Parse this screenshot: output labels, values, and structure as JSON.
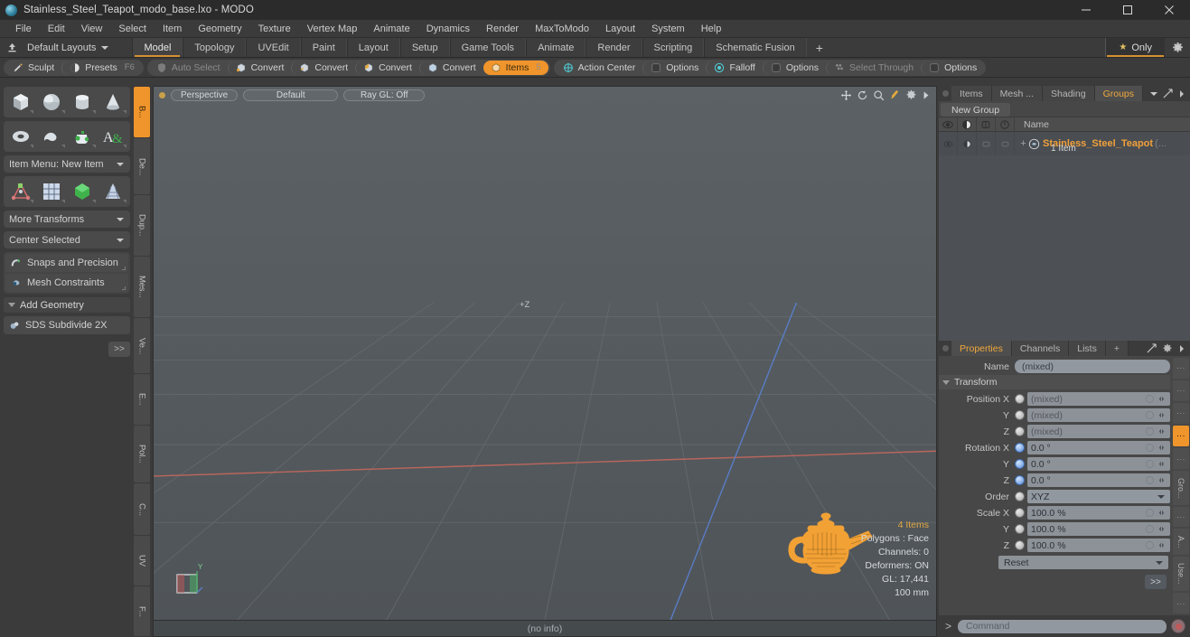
{
  "window": {
    "title": "Stainless_Steel_Teapot_modo_base.lxo - MODO",
    "minimize": "minimize-icon",
    "maximize": "maximize-icon",
    "close": "close-icon"
  },
  "menubar": {
    "items": [
      "File",
      "Edit",
      "View",
      "Select",
      "Item",
      "Geometry",
      "Texture",
      "Vertex Map",
      "Animate",
      "Dynamics",
      "Render",
      "MaxToModo",
      "Layout",
      "System",
      "Help"
    ]
  },
  "layoutbar": {
    "layouts_label": "Default Layouts",
    "tabs": [
      {
        "label": "Model",
        "active": true
      },
      {
        "label": "Topology",
        "active": false
      },
      {
        "label": "UVEdit",
        "active": false
      },
      {
        "label": "Paint",
        "active": false
      },
      {
        "label": "Layout",
        "active": false
      },
      {
        "label": "Setup",
        "active": false
      },
      {
        "label": "Game Tools",
        "active": false
      },
      {
        "label": "Animate",
        "active": false
      },
      {
        "label": "Render",
        "active": false
      },
      {
        "label": "Scripting",
        "active": false
      },
      {
        "label": "Schematic Fusion",
        "active": false
      }
    ],
    "add_tab": "+",
    "only_label": "Only"
  },
  "modebar": {
    "left_group": [
      {
        "label": "Sculpt",
        "key": "",
        "state": "normal",
        "icon": "brush-icon"
      },
      {
        "label": "Presets",
        "key": "F6",
        "state": "normal",
        "icon": "sphere-icon"
      }
    ],
    "center_group": [
      {
        "label": "Auto Select",
        "state": "dim",
        "icon": "shield-icon"
      },
      {
        "label": "Convert",
        "state": "normal",
        "icon": "vertex-icon"
      },
      {
        "label": "Convert",
        "state": "normal",
        "icon": "edge-icon"
      },
      {
        "label": "Convert",
        "state": "normal",
        "icon": "polygon-icon"
      },
      {
        "label": "Convert",
        "state": "normal",
        "icon": "material-icon"
      },
      {
        "label": "Items",
        "state": "active",
        "icon": "items-icon"
      }
    ],
    "right_group": [
      {
        "label": "Action Center",
        "state": "normal",
        "icon": "target-icon"
      },
      {
        "label": "Options",
        "state": "normal",
        "icon": "square-icon"
      },
      {
        "label": "Falloff",
        "state": "normal",
        "icon": "radial-icon"
      },
      {
        "label": "Options",
        "state": "normal",
        "icon": "square-icon"
      },
      {
        "label": "Select Through",
        "state": "dim",
        "icon": "selectthrough-icon"
      },
      {
        "label": "Options",
        "state": "normal",
        "icon": "square-icon"
      }
    ]
  },
  "left_tools": {
    "primitives_row1": [
      "cube-icon",
      "sphere-icon",
      "cylinder-icon",
      "cone-icon"
    ],
    "primitives_row2": [
      "torus-icon",
      "capsule-icon",
      "teapot-icon",
      "text-icon"
    ],
    "item_menu": "Item Menu: New Item",
    "transform_row": [
      "pivot-icon",
      "grid-icon",
      "gem-icon",
      "lattice-icon"
    ],
    "more_transforms": "More Transforms",
    "center_selected": "Center Selected",
    "snaps": "Snaps and Precision",
    "mesh_constraints": "Mesh Constraints",
    "add_geometry": "Add Geometry",
    "sds_subdivide": "SDS Subdivide 2X",
    "more": ">>"
  },
  "vertical_tabs": [
    {
      "label": "B...",
      "active": true
    },
    {
      "label": "De...",
      "active": false
    },
    {
      "label": "Dup...",
      "active": false
    },
    {
      "label": "Mes...",
      "active": false
    },
    {
      "label": "Ve...",
      "active": false
    },
    {
      "label": "E...",
      "active": false
    },
    {
      "label": "Pol...",
      "active": false
    },
    {
      "label": "C...",
      "active": false
    },
    {
      "label": "UV",
      "active": false
    },
    {
      "label": "F...",
      "active": false
    }
  ],
  "viewport": {
    "view_mode": "Perspective",
    "shading": "Default",
    "raygl": "Ray GL: Off",
    "tool_icons": [
      "move-icon",
      "rotate-icon",
      "zoom-icon",
      "flashlight-icon",
      "gear-icon",
      "play-icon"
    ],
    "info": {
      "items": "4 Items",
      "polygons": "Polygons : Face",
      "channels": "Channels: 0",
      "deformers": "Deformers: ON",
      "gl": "GL: 17,441",
      "scale": "100 mm"
    },
    "footer": "(no info)",
    "axis_labels": {
      "z": "+Z",
      "y": "Y"
    }
  },
  "right_panel": {
    "tabs": [
      {
        "label": "Items",
        "active": false
      },
      {
        "label": "Mesh ...",
        "active": false
      },
      {
        "label": "Shading",
        "active": false
      },
      {
        "label": "Groups",
        "active": true
      }
    ],
    "new_group": "New Group",
    "column_icons": [
      "visibility-icon",
      "shading-icon",
      "wireframe-icon",
      "lock-icon"
    ],
    "name_column": "Name",
    "rows": [
      {
        "name": "Stainless_Steel_Teapot",
        "sub": "1 Item",
        "dim": "(..."
      }
    ]
  },
  "properties": {
    "tabs": [
      {
        "label": "Properties",
        "active": true
      },
      {
        "label": "Channels",
        "active": false
      },
      {
        "label": "Lists",
        "active": false
      },
      {
        "label": "+",
        "active": false
      }
    ],
    "name_label": "Name",
    "name_value": "(mixed)",
    "transform_header": "Transform",
    "fields": [
      {
        "label": "Position X",
        "value": "(mixed)",
        "knob": "white",
        "ghost": true
      },
      {
        "label": "Y",
        "value": "(mixed)",
        "knob": "white",
        "ghost": true
      },
      {
        "label": "Z",
        "value": "(mixed)",
        "knob": "white",
        "ghost": true
      },
      {
        "label": "Rotation X",
        "value": "0.0 °",
        "knob": "blue",
        "ghost": false
      },
      {
        "label": "Y",
        "value": "0.0 °",
        "knob": "blue",
        "ghost": false
      },
      {
        "label": "Z",
        "value": "0.0 °",
        "knob": "blue",
        "ghost": false
      }
    ],
    "order_label": "Order",
    "order_value": "XYZ",
    "scale_fields": [
      {
        "label": "Scale X",
        "value": "100.0 %"
      },
      {
        "label": "Y",
        "value": "100.0 %"
      },
      {
        "label": "Z",
        "value": "100.0 %"
      }
    ],
    "reset": "Reset",
    "more": ">>",
    "side_tabs": [
      "",
      "",
      "",
      "",
      "Gro...",
      "",
      "A...",
      "Use...",
      ""
    ]
  },
  "command_bar": {
    "prompt": ">",
    "placeholder": "Command",
    "record": "record-icon"
  },
  "colors": {
    "accent_orange": "#f0952b",
    "item_orange": "#f0a03c",
    "viewport_bg": "#555b5f",
    "panel_bg": "#474747",
    "chrome_bg": "#3b3b3b"
  }
}
